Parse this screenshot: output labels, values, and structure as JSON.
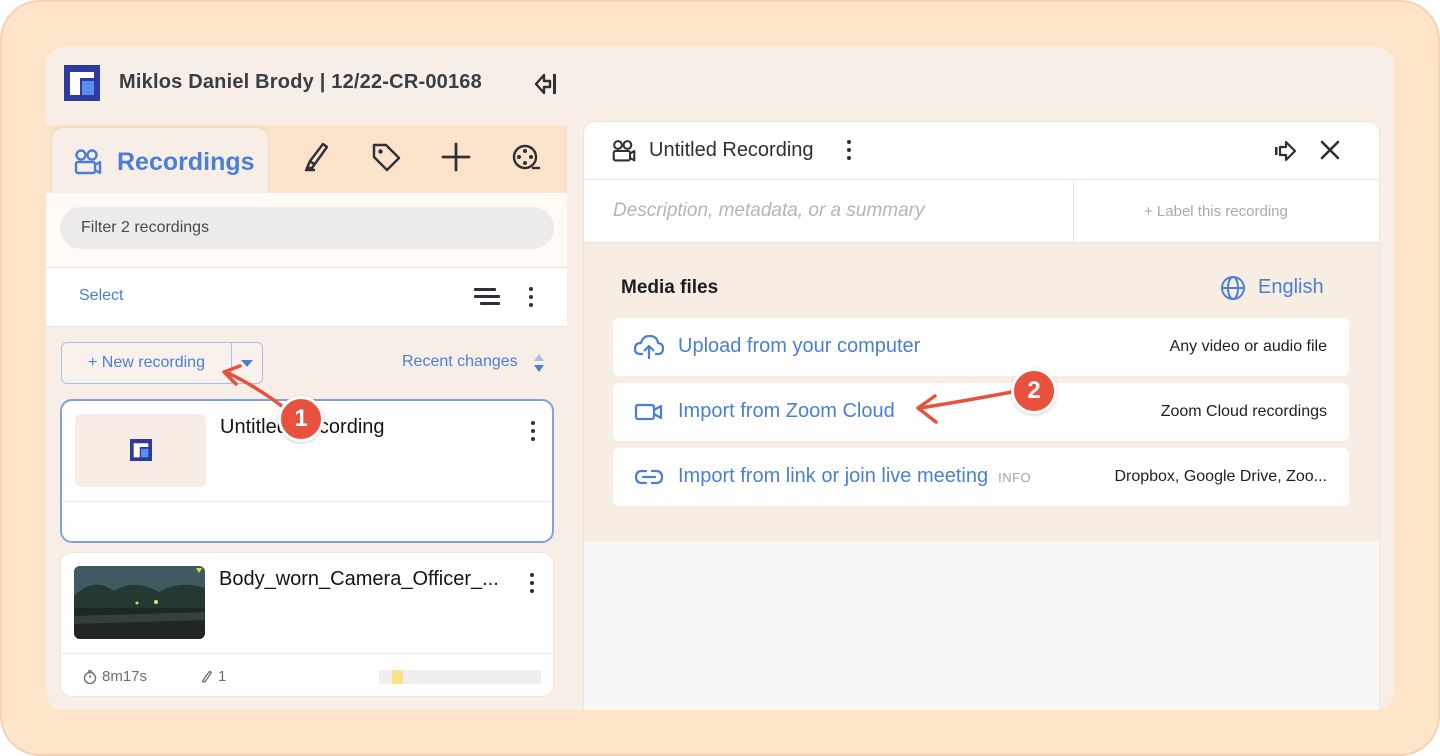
{
  "header": {
    "case_title": "Miklos Daniel Brody | 12/22-CR-00168"
  },
  "left_panel": {
    "tabs": {
      "active_label": "Recordings",
      "icons": [
        "highlighter-icon",
        "tag-icon",
        "plus-icon",
        "film-reel-icon"
      ]
    },
    "filter_placeholder": "Filter 2 recordings",
    "select_label": "Select",
    "new_recording_label": "+ New recording",
    "sort_label": "Recent changes",
    "recordings": [
      {
        "title": "Untitled Recording",
        "duration": "",
        "highlights": ""
      },
      {
        "title": "Body_worn_Camera_Officer_...",
        "duration": "8m17s",
        "highlights": "1"
      }
    ]
  },
  "right_panel": {
    "title": "Untitled Recording",
    "description_placeholder": "Description, metadata, or a summary",
    "label_link": "+ Label this recording",
    "media_files_title": "Media files",
    "language": "English",
    "options": [
      {
        "label": "Upload from your computer",
        "hint": "Any video or audio file",
        "info": ""
      },
      {
        "label": "Import from Zoom Cloud",
        "hint": "Zoom Cloud recordings",
        "info": ""
      },
      {
        "label": "Import from link or join live meeting",
        "hint": "Dropbox, Google Drive, Zoo...",
        "info": "INFO"
      }
    ]
  },
  "annotations": {
    "step1": "1",
    "step2": "2"
  },
  "colors": {
    "accent": "#4a7fd4",
    "annotation": "#e8513d",
    "frame": "#fee4c8"
  }
}
